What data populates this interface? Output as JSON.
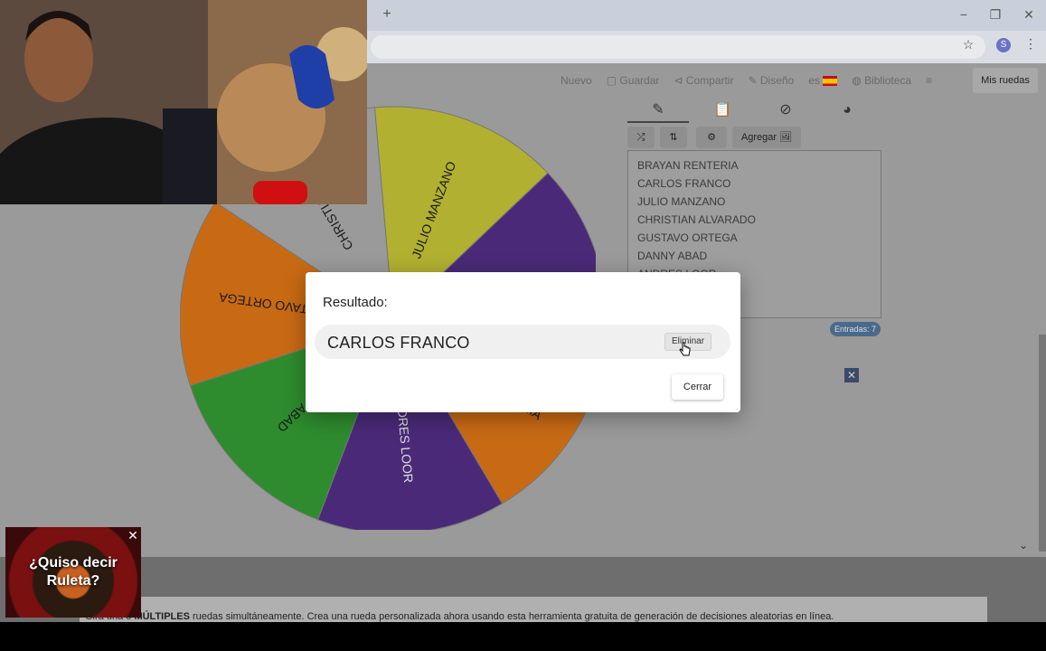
{
  "browser": {
    "new_tab_glyph": "+",
    "minimize_glyph": "−",
    "restore_glyph": "❐",
    "close_glyph": "✕",
    "star_glyph": "☆",
    "profile_initial": "S",
    "menu_glyph": "⋮"
  },
  "nav": {
    "items": [
      "Nuevo",
      "Guardar",
      "Compartir",
      "Diseño",
      "es",
      "Biblioteca"
    ],
    "my_wheels": "Mis ruedas"
  },
  "editor": {
    "tabs": [
      "pencil-icon",
      "clipboard-icon",
      "hidden-icon",
      "palette-icon"
    ],
    "tools": {
      "shuffle": "⤮",
      "sort": "⇅",
      "settings": "⚙",
      "add": "Agregar 🖼"
    },
    "entries": [
      "BRAYAN RENTERIA",
      "CARLOS FRANCO",
      "JULIO MANZANO",
      "CHRISTIAN ALVARADO",
      "GUSTAVO ORTEGA",
      "DANNY ABAD",
      "ANDRES LOOR"
    ],
    "entries_count": "Entradas: 7"
  },
  "wheel": {
    "segments": [
      {
        "label": "JULIO MANZANO",
        "color": "#b2b030"
      },
      {
        "label": "",
        "color": "#4a2a78"
      },
      {
        "label": "BRAYAN RENTERIA",
        "color": "#c86a14"
      },
      {
        "label": "ANDRES LOOR",
        "color": "#4a2a78"
      },
      {
        "label": "DANNY ABAD",
        "color": "#2e8c2e"
      },
      {
        "label": "GUSTAVO ORTEGA",
        "color": "#c86a14"
      },
      {
        "label": "CHRISTIAN",
        "color": "#9a9a9a"
      }
    ]
  },
  "modal": {
    "title": "Resultado:",
    "winner": "CARLOS FRANCO",
    "remove_label": "Eliminar",
    "close_label": "Cerrar"
  },
  "ad": {
    "text_line1": "¿Quiso decir",
    "text_line2": "Ruleta?",
    "close_glyph": "✕"
  },
  "footer": {
    "description_prefix": "Gira una o",
    "description_bold": "MÚLTIPLES",
    "description_rest": "ruedas simultáneamente. Crea una rueda personalizada ahora usando esta herramienta gratuita de generación de decisiones aleatorias en línea."
  },
  "colors": {
    "modal_bg": "#ffffff",
    "overlay": "#9a9a9a"
  }
}
